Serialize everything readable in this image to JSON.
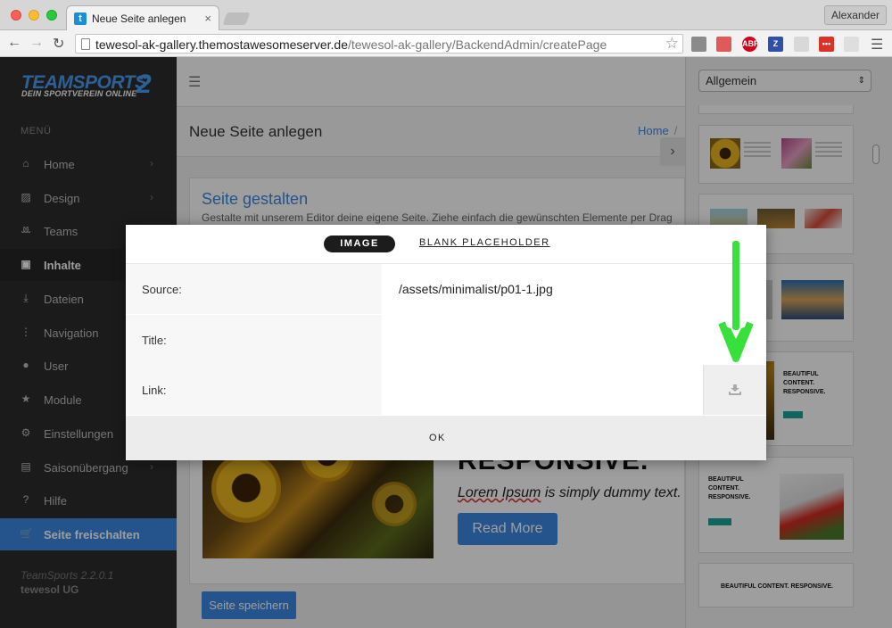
{
  "browser": {
    "tab_title": "Neue Seite anlegen",
    "tab_favicon": "t",
    "tab_close": "×",
    "profile_name": "Alexander",
    "url_host": "tewesol-ak-gallery.themostawesomeserver.de",
    "url_path": "/tewesol-ak-gallery/BackendAdmin/createPage",
    "back_icon": "←",
    "forward_icon": "→",
    "reload_icon": "↻",
    "star_icon": "☆",
    "menu_icon": "☰",
    "extensions": [
      {
        "name": "extension-chart-icon",
        "label": "",
        "color": "#8a8a8a"
      },
      {
        "name": "extension-dots-icon",
        "label": "",
        "color": "#e05a5a"
      },
      {
        "name": "adblock-plus-icon",
        "label": "ABP",
        "color": "#d0021b"
      },
      {
        "name": "extension-z-icon",
        "label": "Z",
        "color": "#2f4fa8"
      },
      {
        "name": "extension-doc-icon",
        "label": "",
        "color": "#d8d8d8"
      },
      {
        "name": "extension-red-dots-icon",
        "label": "•••",
        "color": "#d9322b"
      },
      {
        "name": "extension-grid-icon",
        "label": "",
        "color": "#dedede"
      }
    ]
  },
  "sidebar": {
    "logo_main": "TEAMSPORTS",
    "logo_number": "2",
    "logo_sub": "DEIN SPORTVEREIN ONLINE",
    "menu_heading": "MENÜ",
    "items": [
      {
        "label": "Home",
        "icon": "⌂",
        "chevron": "›"
      },
      {
        "label": "Design",
        "icon": "▨",
        "chevron": "›"
      },
      {
        "label": "Teams",
        "icon": "ꔛ",
        "chevron": ""
      },
      {
        "label": "Inhalte",
        "icon": "▣",
        "chevron": ""
      },
      {
        "label": "Dateien",
        "icon": "⤓",
        "chevron": ""
      },
      {
        "label": "Navigation",
        "icon": "⋮",
        "chevron": ""
      },
      {
        "label": "User",
        "icon": "●",
        "chevron": ""
      },
      {
        "label": "Module",
        "icon": "★",
        "chevron": ""
      },
      {
        "label": "Einstellungen",
        "icon": "⚙",
        "chevron": ""
      },
      {
        "label": "Saisonübergang",
        "icon": "▤",
        "chevron": "›"
      },
      {
        "label": "Hilfe",
        "icon": "?",
        "chevron": ""
      },
      {
        "label": "Seite freischalten",
        "icon": "🛒",
        "chevron": ""
      }
    ],
    "version": "TeamSports 2.2.0.1",
    "company": "tewesol UG"
  },
  "main": {
    "hamburger_icon": "☰",
    "page_title": "Neue Seite anlegen",
    "breadcrumb_home": "Home",
    "breadcrumb_sep": "/",
    "card_title": "Seite gestalten",
    "card_desc": "Gestalte mit unserem Editor deine eigene Seite. Ziehe einfach die gewünschten Elemente per Drag",
    "hero_heading": "RESPONSIVE.",
    "lorem_text": "Lorem Ipsum",
    "lorem_rest": " is simply dummy text.",
    "read_more": "Read More",
    "save_button": "Seite speichern",
    "collapse_icon": "›"
  },
  "rightpanel": {
    "select_value": "Allgemein",
    "select_arrow": "⇕",
    "thumb_texts": {
      "t4_heading": "BEAUTIFUL CONTENT. RESPONSIVE.",
      "t5_heading": "BEAUTIFUL CONTENT. RESPONSIVE.",
      "t6_heading": "BEAUTIFUL CONTENT. RESPONSIVE."
    }
  },
  "modal": {
    "tab_image": "IMAGE",
    "tab_blank": "BLANK PLACEHOLDER",
    "source_label": "Source:",
    "source_value": "/assets/minimalist/p01-1.jpg",
    "title_label": "Title:",
    "title_value": "",
    "link_label": "Link:",
    "link_value": "",
    "ok_label": "OK"
  },
  "colors": {
    "accent": "#3c86e0",
    "sidebar_bg": "#2d2d2d",
    "annotation_arrow": "#37e03a"
  }
}
